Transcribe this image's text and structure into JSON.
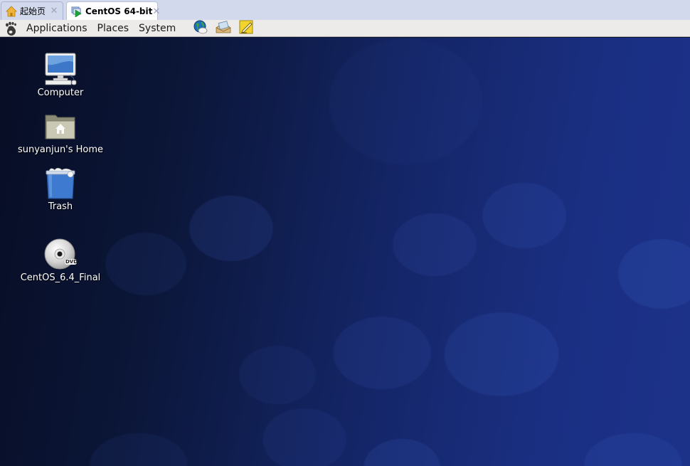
{
  "tabs": [
    {
      "label": "起始页",
      "icon": "home-icon",
      "active": false
    },
    {
      "label": "CentOS 64-bit",
      "icon": "vm-power-on-icon",
      "active": true
    }
  ],
  "tab_close_glyph": "✕",
  "panel": {
    "menus": [
      {
        "label": "Applications"
      },
      {
        "label": "Places"
      },
      {
        "label": "System"
      }
    ],
    "launchers": [
      {
        "name": "web-browser-launcher",
        "icon": "globe-mail-icon"
      },
      {
        "name": "email-launcher",
        "icon": "mail-envelope-icon"
      },
      {
        "name": "text-editor-launcher",
        "icon": "note-pencil-icon"
      }
    ]
  },
  "desktop": {
    "icons": [
      {
        "label": "Computer",
        "icon": "computer-icon"
      },
      {
        "label": "sunyanjun's Home",
        "icon": "home-folder-icon"
      },
      {
        "label": "Trash",
        "icon": "trash-icon"
      },
      {
        "label": "CentOS_6.4_Final",
        "icon": "dvd-icon",
        "badge": "DVD"
      }
    ]
  },
  "colors": {
    "tabstrip_bg": "#d3d9ec",
    "panel_bg": "#ecebe9",
    "desktop_dark": "#070d24",
    "desktop_light": "#1c3289"
  }
}
